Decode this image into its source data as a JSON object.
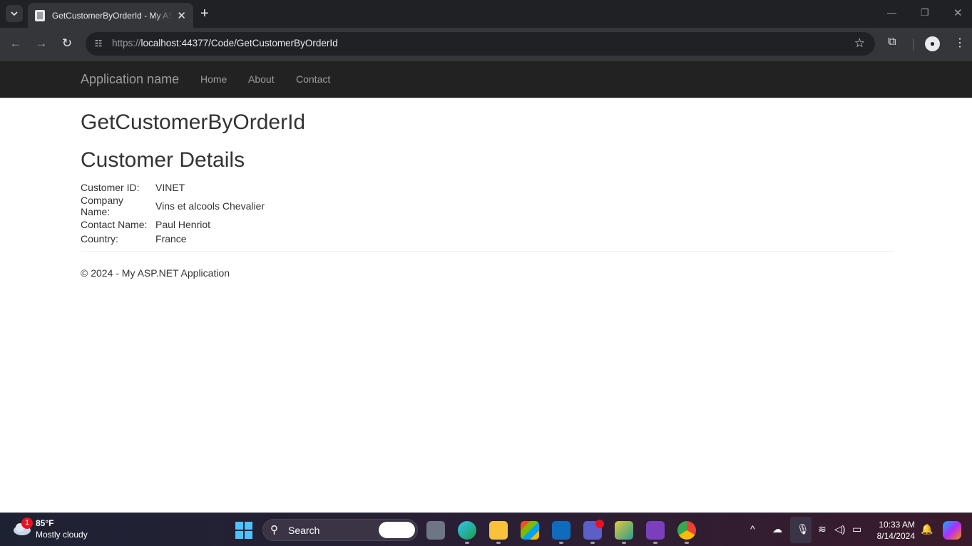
{
  "browser": {
    "tab_title": "GetCustomerByOrderId - My ASP.NET Application",
    "url_prefix": "https://",
    "url_host": "localhost",
    "url_rest": ":44377/Code/GetCustomerByOrderId"
  },
  "site": {
    "brand": "Application name",
    "nav": [
      "Home",
      "About",
      "Contact"
    ],
    "page_title": "GetCustomerByOrderId",
    "section_title": "Customer Details",
    "details": [
      {
        "label": "Customer ID:",
        "value": "VINET"
      },
      {
        "label": "Company Name:",
        "value": "Vins et alcools Chevalier"
      },
      {
        "label": "Contact Name:",
        "value": "Paul Henriot"
      },
      {
        "label": "Country:",
        "value": "France"
      }
    ],
    "footer": "© 2024 - My ASP.NET Application"
  },
  "taskbar": {
    "weather_badge": "1",
    "temperature": "85°F",
    "condition": "Mostly cloudy",
    "search_label": "Search",
    "time": "10:33 AM",
    "date": "8/14/2024"
  },
  "colors": {
    "navbar": "#222222",
    "browser_dark": "#202124",
    "accent": "#4cc2ff"
  }
}
